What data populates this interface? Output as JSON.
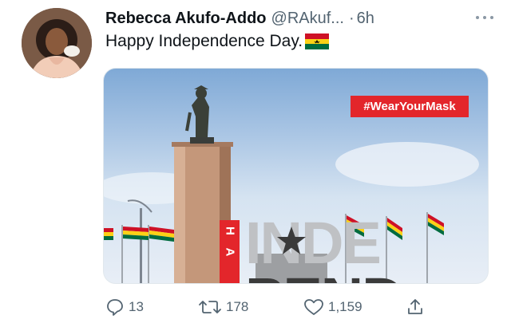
{
  "tweet": {
    "author_name": "Rebecca Akufo-Addo",
    "handle": "@RAkuf...",
    "separator": "·",
    "time": "6h",
    "text": "Happy Independence Day.",
    "emoji": "ghana-flag-emoji"
  },
  "media": {
    "hashtag": "#WearYourMask",
    "side_text": "H A",
    "big_text": "INDE",
    "big_text_bottom": "PEND"
  },
  "actions": {
    "replies": "13",
    "retweets": "178",
    "likes": "1,159"
  },
  "colors": {
    "text": "#0f1419",
    "muted": "#536471",
    "accent_red": "#e3262b",
    "flag_red": "#ce1126",
    "flag_gold": "#fcd116",
    "flag_green": "#006b3f"
  }
}
